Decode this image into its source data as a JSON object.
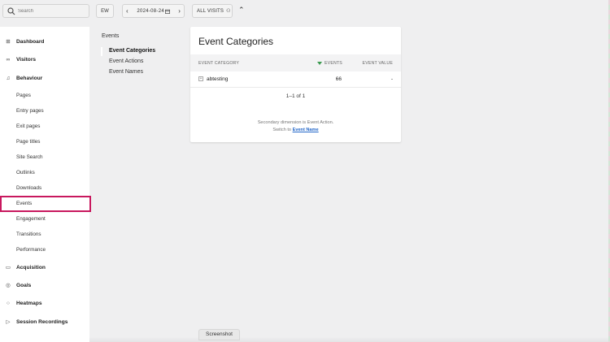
{
  "topbar": {
    "search_placeholder": "Search",
    "period": "EW",
    "date": "2024-08-24",
    "segment": "ALL VISITS",
    "segment_icon": "⚇"
  },
  "sidebar": {
    "main": [
      {
        "label": "Dashboard",
        "icon": "grid-icon",
        "glyph": "⊞"
      },
      {
        "label": "Visitors",
        "icon": "glasses-icon",
        "glyph": "∞"
      },
      {
        "label": "Behaviour",
        "icon": "bell-icon",
        "glyph": "♫"
      }
    ],
    "behaviour_items": [
      "Pages",
      "Entry pages",
      "Exit pages",
      "Page titles",
      "Site Search",
      "Outlinks",
      "Downloads",
      "Events",
      "Engagement",
      "Transitions",
      "Performance"
    ],
    "lower": [
      {
        "label": "Acquisition",
        "icon": "box-icon",
        "glyph": "▭"
      },
      {
        "label": "Goals",
        "icon": "target-icon",
        "glyph": "◎"
      },
      {
        "label": "Heatmaps",
        "icon": "circle-icon",
        "glyph": "○"
      },
      {
        "label": "Session Recordings",
        "icon": "play-icon",
        "glyph": "▷"
      }
    ],
    "active_item": "Events"
  },
  "subnav": {
    "title": "Events",
    "items": [
      "Event Categories",
      "Event Actions",
      "Event Names"
    ]
  },
  "report": {
    "title": "Event Categories",
    "columns": [
      "EVENT CATEGORY",
      "EVENTS",
      "EVENT VALUE"
    ],
    "rows": [
      {
        "category": "abtesting",
        "events": "66",
        "value": "-"
      }
    ],
    "pagination": "1–1 of 1",
    "note_line1": "Secondary dimension is Event Action.",
    "note_line2": "Switch to",
    "note_link": "Event Name"
  },
  "screenshot_tab": "Screenshot",
  "colors": {
    "highlight": "#c8185e",
    "sort_arrow": "#3a9a4f",
    "link": "#2266c8"
  }
}
